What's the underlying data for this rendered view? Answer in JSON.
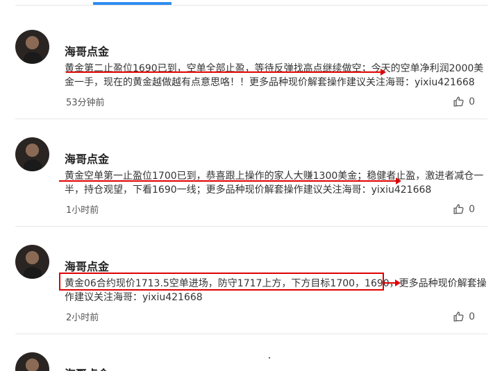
{
  "colors": {
    "accent": "#2d8cf0",
    "annotation": "#e00000"
  },
  "posts": [
    {
      "author": "海哥点金",
      "content": "黄金第二止盈位1690已到，空单全部止盈，等待反弹找高点继续做空；今天的空单净利润2000美金一手，现在的黄金越做越有点意思咯！！更多品种现价解套操作建议关注海哥：yixiu421668",
      "time": "53分钟前",
      "likes": "0"
    },
    {
      "author": "海哥点金",
      "content": "黄金空单第一止盈位1700已到，恭喜跟上操作的家人大赚1300美金；稳健者止盈，激进者减仓一半，持仓观望，下看1690一线；更多品种现价解套操作建议关注海哥：yixiu421668",
      "time": "1小时前",
      "likes": "0"
    },
    {
      "author": "海哥点金",
      "content": "黄金06合约现价1713.5空单进场，防守1717上方，下方目标1700，1690，更多品种现价解套操作建议关注海哥：yixiu421668",
      "time": "2小时前",
      "likes": "0"
    },
    {
      "author": "海哥点金"
    }
  ]
}
